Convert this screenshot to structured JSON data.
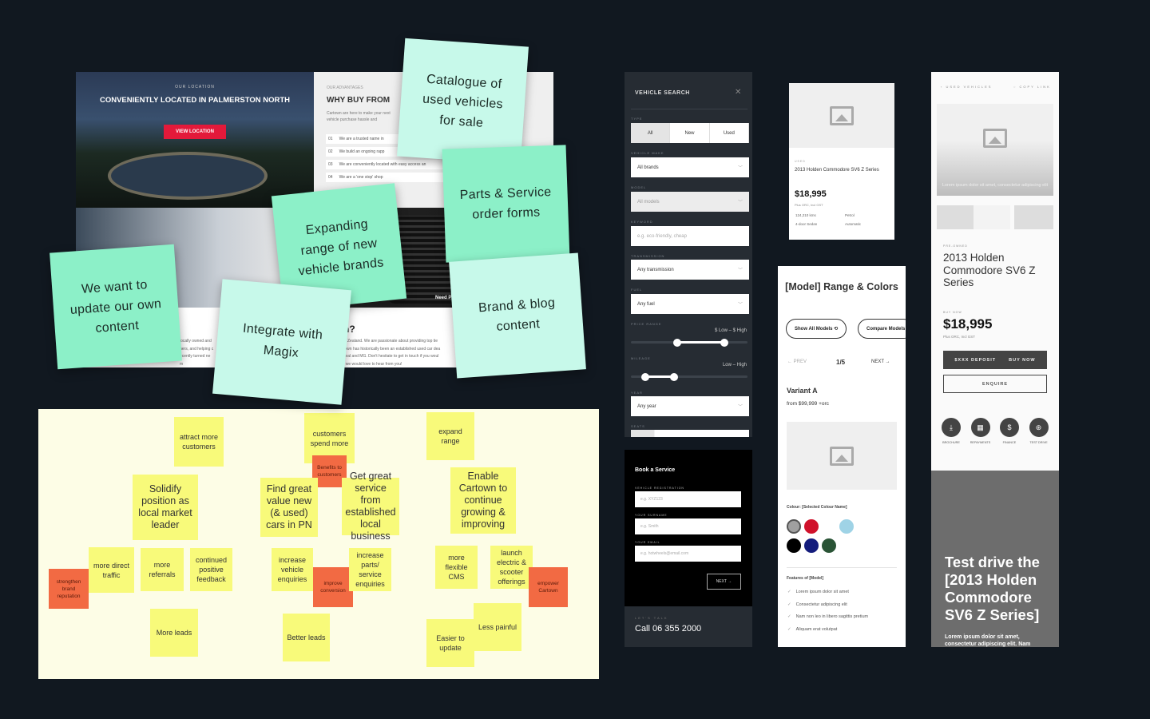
{
  "website": {
    "hero_kicker": "OUR LOCATION",
    "hero_title": "CONVENIENTLY LOCATED IN PALMERSTON NORTH",
    "hero_button": "VIEW LOCATION",
    "why_kicker": "OUR ADVANTAGES",
    "why_title": "WHY BUY FROM",
    "why_desc": "Cartown are here to make your next vehicle purchase hassle and",
    "why_items": [
      {
        "num": "01",
        "text": "We are a trusted name in"
      },
      {
        "num": "02",
        "text": "We build an ongoing rapp"
      },
      {
        "num": "03",
        "text": "We are conveniently located with easy access an"
      },
      {
        "num": "04",
        "text": "We are a 'one stop' shop"
      }
    ],
    "need_text": "Need P",
    "about_heading": "n?",
    "about_left": [
      "locally owned and",
      "ners, and helping c",
      "ecently turned ne",
      "m"
    ],
    "about_right": [
      "w Zealand. We are passionate about providing top tie",
      "town has historically been an established used car dea",
      "aval and MG. Don't hesitate to get in touch if you woul",
      ", we would love to hear from you!"
    ]
  },
  "stickies": [
    "Catalogue of used vehicles for sale",
    "Parts & Service order forms",
    "Expanding range of new vehicle brands",
    "We want to update our own content",
    "Integrate with Magix",
    "Brand & blog content"
  ],
  "board_notes": [
    "attract more customers",
    "customers spend more",
    "Benefits to customers",
    "expand range",
    "Solidify position as local market leader",
    "Find great value new (& used) cars in PN",
    "Get great service from established local business",
    "Enable Cartown to continue growing & improving",
    "more direct traffic",
    "strengthen brand reputation",
    "more referrals",
    "continued positive feedback",
    "increase vehicle enquiries",
    "improve conversion",
    "increase parts/ service enquiries",
    "more flexible CMS",
    "launch electric & scooter offerings",
    "empower Cartown",
    "More leads",
    "Better leads",
    "Easier to update",
    "Less painful"
  ],
  "vehicle_search": {
    "title": "VEHICLE SEARCH",
    "type_label": "TYPE",
    "type_options": [
      "All",
      "New",
      "Used"
    ],
    "type_selected": "All",
    "make_label": "VEHICLE MAKE",
    "make_value": "All brands",
    "model_label": "MODEL",
    "model_value": "All models",
    "keyword_label": "KEYWORD",
    "keyword_placeholder": "e.g. eco-friendly, cheap",
    "transmission_label": "TRANSMISSION",
    "transmission_value": "Any transmission",
    "fuel_label": "FUEL",
    "fuel_value": "Any fuel",
    "price_label": "PRICE RANGE",
    "price_value": "$ Low – $ High",
    "price_range_pct": [
      40,
      80
    ],
    "mileage_label": "MILEAGE",
    "mileage_value": "Low – High",
    "mileage_range_pct": [
      12,
      37
    ],
    "year_label": "YEAR",
    "year_value": "Any year",
    "seats_label": "SEATS"
  },
  "book_service": {
    "title": "Book a Service",
    "fields": [
      {
        "label": "VEHICLE REGISTRATION",
        "placeholder": "e.g. XYZ123"
      },
      {
        "label": "YOUR SURNAME",
        "placeholder": "e.g. Smith"
      },
      {
        "label": "YOUR EMAIL",
        "placeholder": "e.g. hotwheels@email.com"
      }
    ],
    "next": "NEXT →",
    "talk_kicker": "LET'S TALK",
    "phone": "Call 06 355 2000"
  },
  "card": {
    "badge": "USED",
    "title": "2013 Holden Commodore SV6 Z Series",
    "price": "$18,995",
    "price_note": "Plus ORC, Incl GST",
    "specs": [
      "124,210 kms",
      "Petrol",
      "4-door Sedan",
      "Automatic"
    ]
  },
  "model_range": {
    "title": "[Model] Range & Colors",
    "show_all": "Show All Models ⟲",
    "compare": "Compare Models",
    "prev": "← PREV",
    "page": "1/5",
    "next": "NEXT →",
    "variant": "Variant A",
    "variant_price": "from $99,999 +orc",
    "colour_label": "Colour: [Selected Colour Name]",
    "colours": [
      "#a0a0a0",
      "#d0112b",
      "#ffffff",
      "#9fd3e6",
      "#000000",
      "#141c7c",
      "#2a5436"
    ],
    "features_title": "Features of [Model]",
    "features": [
      "Lorem ipsum dolor sit amet",
      "Consectetur adipiscing elit",
      "Nam non leo in libero sagittis pretium",
      "Aliquam erat volutpat"
    ]
  },
  "detail": {
    "back": "‹  USED VEHICLES",
    "copy": "COPY LINK",
    "caption": "Lorem ipsum dolor sit amet, consectetur adipiscing elit",
    "kicker": "PRE-OWNED",
    "title": "2013 Holden Commodore SV6 Z Series",
    "buy_kicker": "BUY NOW",
    "price": "$18,995",
    "price_note": "Plus ORC, Incl GST",
    "deposit": "$XXX DEPOSIT",
    "buy": "BUY NOW",
    "enquire": "ENQUIRE",
    "actions": [
      {
        "label": "BROCHURE",
        "icon": "download-icon"
      },
      {
        "label": "REPAYMENTS",
        "icon": "calculator-icon"
      },
      {
        "label": "FINANCE",
        "icon": "money-bag-icon"
      },
      {
        "label": "TEST DRIVE",
        "icon": "steering-wheel-icon"
      }
    ],
    "test_drive_title": "Test drive the [2013 Holden Commodore SV6 Z Series]",
    "test_drive_text": "Lorem ipsum dolor sit amet, consectetur adipiscing elit. Nam"
  },
  "colors": {
    "background": "#111820",
    "sticky_mint": "#8cf0c8",
    "sticky_pale": "#c7f9ea",
    "postit_yellow": "#f8fa7a",
    "postit_orange": "#f26a43",
    "brand_red": "#e3193a"
  }
}
